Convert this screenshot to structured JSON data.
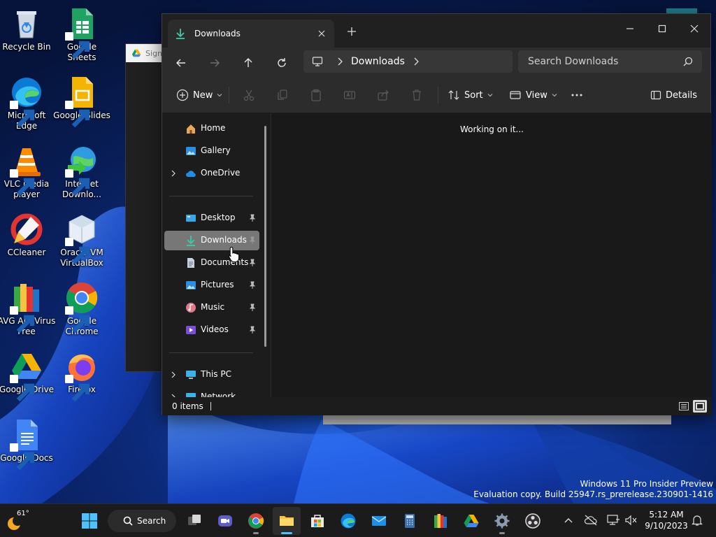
{
  "desktop": {
    "icons": [
      {
        "label": "Recycle Bin"
      },
      {
        "label": "Google Sheets"
      },
      {
        "label": "Microsoft Edge"
      },
      {
        "label": "Google Slides"
      },
      {
        "label": "VLC media player"
      },
      {
        "label": "Internet Downlo..."
      },
      {
        "label": "CCleaner"
      },
      {
        "label": "Oracle VM VirtualBox"
      },
      {
        "label": "AVG AntiVirus Free"
      },
      {
        "label": "Google Chrome"
      },
      {
        "label": "Google Drive"
      },
      {
        "label": "Firefox"
      },
      {
        "label": "Google Docs"
      }
    ],
    "background_window_tab": "Sign"
  },
  "explorer": {
    "tab_title": "Downloads",
    "breadcrumb": {
      "location": "Downloads"
    },
    "search_placeholder": "Search Downloads",
    "commands": {
      "new": "New",
      "sort": "Sort",
      "view": "View",
      "details": "Details"
    },
    "nav": {
      "home": "Home",
      "gallery": "Gallery",
      "onedrive": "OneDrive",
      "desktop": "Desktop",
      "downloads": "Downloads",
      "documents": "Documents",
      "pictures": "Pictures",
      "music": "Music",
      "videos": "Videos",
      "this_pc": "This PC",
      "network": "Network"
    },
    "content_status": "Working on it...",
    "status_items": "0 items"
  },
  "watermark": {
    "line1": "Windows 11 Pro Insider Preview",
    "line2": "Evaluation copy. Build 25947.rs_prerelease.230901-1416"
  },
  "taskbar": {
    "weather_temp": "61°",
    "search_label": "Search",
    "time": "5:12 AM",
    "date": "9/10/2023"
  },
  "colors": {
    "accent": "#4cc2ff",
    "download_green": "#3ec9a7",
    "window_bg": "#191919",
    "toolbar_bg": "#2c2c2c",
    "selected_nav": "#777777"
  }
}
